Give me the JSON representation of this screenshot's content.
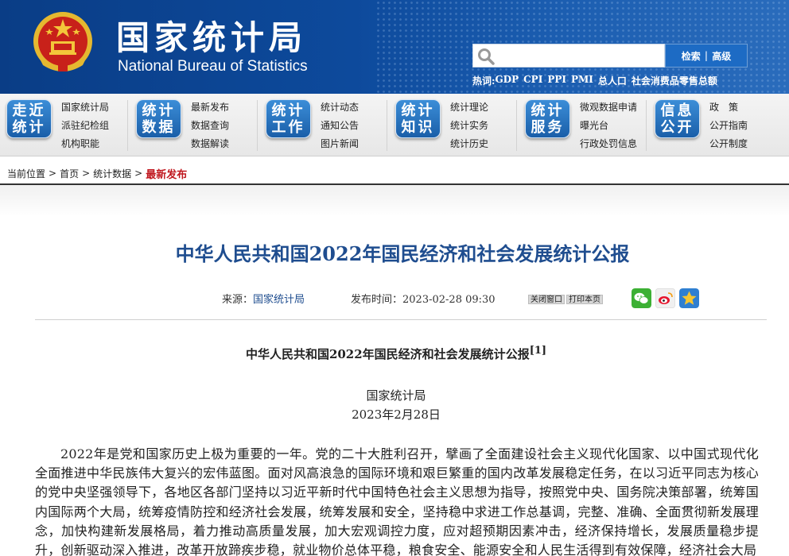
{
  "header": {
    "title": "国家统计局",
    "subtitle": "National Bureau of Statistics",
    "search": {
      "placeholder": "",
      "search_label": "检索",
      "advanced_label": "高级"
    },
    "hot_label": "热词:",
    "hot_words": [
      "GDP",
      "CPI",
      "PPI",
      "PMI",
      "总人口",
      "社会消费品零售总额"
    ]
  },
  "nav": [
    {
      "badge": [
        "走近",
        "统计"
      ],
      "links": [
        "国家统计局",
        "派驻纪检组",
        "机构职能"
      ]
    },
    {
      "badge": [
        "统计",
        "数据"
      ],
      "links": [
        "最新发布",
        "数据查询",
        "数据解读"
      ]
    },
    {
      "badge": [
        "统计",
        "工作"
      ],
      "links": [
        "统计动态",
        "通知公告",
        "图片新闻"
      ]
    },
    {
      "badge": [
        "统计",
        "知识"
      ],
      "links": [
        "统计理论",
        "统计实务",
        "统计历史"
      ]
    },
    {
      "badge": [
        "统计",
        "服务"
      ],
      "links": [
        "微观数据申请",
        "曝光台",
        "行政处罚信息"
      ]
    },
    {
      "badge": [
        "信息",
        "公开"
      ],
      "links": [
        "政　策",
        "公开指南",
        "公开制度"
      ]
    }
  ],
  "breadcrumb": {
    "label": "当前位置",
    "items": [
      "首页",
      "统计数据"
    ],
    "current": "最新发布",
    "sep": ">"
  },
  "article": {
    "title": "中华人民共和国2022年国民经济和社会发展统计公报",
    "source_label": "来源：",
    "source": "国家统计局",
    "time_label": "发布时间：",
    "time": "2023-02-28 09:30",
    "close_btn": "关闭窗口",
    "print_btn": "打印本页",
    "doc_title": "中华人民共和国2022年国民经济和社会发展统计公报",
    "doc_note": "[1]",
    "org": "国家统计局",
    "date": "2023年2月28日",
    "paragraph": "2022年是党和国家历史上极为重要的一年。党的二十大胜利召开，擘画了全面建设社会主义现代化国家、以中国式现代化全面推进中华民族伟大复兴的宏伟蓝图。面对风高浪急的国际环境和艰巨繁重的国内改革发展稳定任务，在以习近平同志为核心的党中央坚强领导下，各地区各部门坚持以习近平新时代中国特色社会主义思想为指导，按照党中央、国务院决策部署，统筹国内国际两个大局，统筹疫情防控和经济社会发展，统筹发展和安全，坚持稳中求进工作总基调，完整、准确、全面贯彻新发展理念，加快构建新发展格局，着力推动高质量发展，加大宏观调控力度，应对超预期因素冲击，经济保持增长，发展质量稳步提升，创新驱动深入推进，改革开放蹄疾步稳，就业物价总体平稳，粮食安全、能源安全和人民生活得到有效保障，经济社会大局"
  },
  "colors": {
    "brand_blue": "#0d4a9c",
    "title_blue": "#1f4d8f",
    "current_red": "#c0171e"
  }
}
